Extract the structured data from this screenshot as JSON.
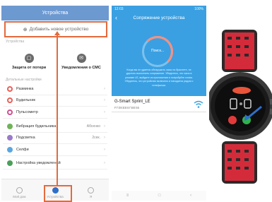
{
  "left_phone": {
    "title": "Устройства",
    "add_device": "Добавить новое устройство",
    "section_devices": "Устройства",
    "tiles": [
      {
        "label": "Защита от потери",
        "icon": "device-icon"
      },
      {
        "label": "Уведомления о СМС",
        "icon": "message-icon"
      }
    ],
    "section_settings": "Детальные настройки",
    "list_a": [
      {
        "label": "Разминка",
        "color": "#e8605a",
        "value": ""
      },
      {
        "label": "Будильник",
        "color": "#e8605a",
        "value": ""
      },
      {
        "label": "Пульсометр",
        "color": "#d04f8f",
        "value": ""
      }
    ],
    "list_b": [
      {
        "label": "Вибрация будильника",
        "color": "#6fb35a",
        "value": "Абсенко"
      },
      {
        "label": "Подсветка",
        "color": "#9a7acb",
        "value": "2сек."
      },
      {
        "label": "Селфи",
        "color": "#5aa7e0",
        "value": ""
      }
    ],
    "list_c": [
      {
        "label": "Настройка уведомлений",
        "color": "#4b9f5a",
        "value": ""
      }
    ],
    "tabs": [
      {
        "label": "Мой дом",
        "active": false
      },
      {
        "label": "Устройства",
        "active": true
      },
      {
        "label": "Я",
        "active": false
      }
    ]
  },
  "mid_phone": {
    "status_left": "12:03",
    "status_right": "100%",
    "title": "Сопряжение устройства",
    "spinner_label": "Поиск...",
    "info_text": "Когда вы не удается обнаружить часы на браслете, не удалось выполнить сопряжение. Убедитесь, что часы в режиме LE, выйдите из приложения и попробуйте снова. Убедитесь, что устройство включено и находится рядом с телефоном.",
    "device_name": "G-Smart Sprint_LE",
    "device_mac": "F7:08:E8:67:B0:55",
    "nav": [
      "≡",
      "□",
      "‹"
    ]
  },
  "colors": {
    "accent": "#e36a3c",
    "header_blue": "#6d99d1",
    "scan_blue": "#3aa0e2"
  }
}
